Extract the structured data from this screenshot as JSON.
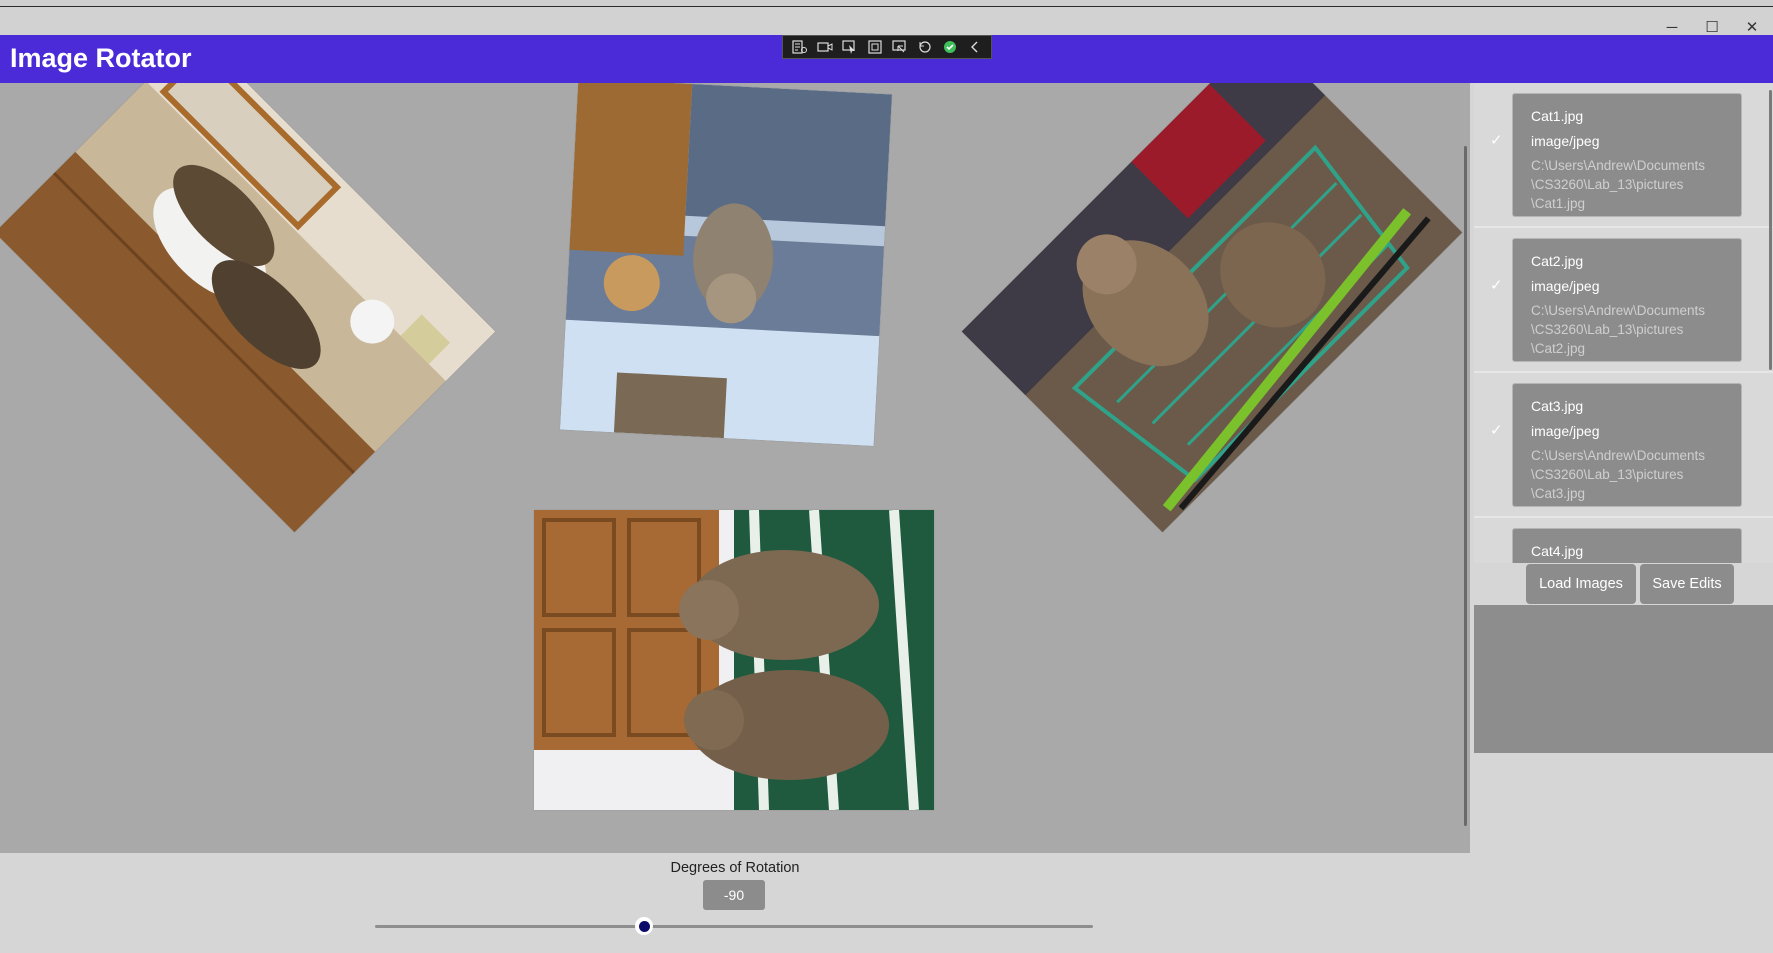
{
  "window": {
    "title": "Image Rotator",
    "controls": {
      "minimize": "─",
      "maximize": "☐",
      "close": "✕"
    }
  },
  "debug_toolbar": {
    "icons": [
      "live-visual-tree-icon",
      "select-element-icon",
      "display-layout-adorners-icon",
      "track-focus-icon",
      "hot-reload-icon",
      "binding-failures-icon",
      "collapse-chevron-icon"
    ]
  },
  "images": [
    {
      "name": "cat1-photo",
      "rotation_deg": 45
    },
    {
      "name": "cat2-photo",
      "rotation_deg": 183
    },
    {
      "name": "cat3-photo",
      "rotation_deg": -45
    },
    {
      "name": "cat4-photo",
      "rotation_deg": -90
    }
  ],
  "sidebar": {
    "items": [
      {
        "name": "Cat1.jpg",
        "type": "image/jpeg",
        "path": "C:\\Users\\Andrew\\Documents\n\\CS3260\\Lab_13\\pictures\n\\Cat1.jpg",
        "checked": "✓"
      },
      {
        "name": "Cat2.jpg",
        "type": "image/jpeg",
        "path": "C:\\Users\\Andrew\\Documents\n\\CS3260\\Lab_13\\pictures\n\\Cat2.jpg",
        "checked": "✓"
      },
      {
        "name": "Cat3.jpg",
        "type": "image/jpeg",
        "path": "C:\\Users\\Andrew\\Documents\n\\CS3260\\Lab_13\\pictures\n\\Cat3.jpg",
        "checked": "✓"
      },
      {
        "name": "Cat4.jpg",
        "type": "",
        "path": "",
        "checked": ""
      }
    ],
    "load_button": "Load Images",
    "save_button": "Save Edits"
  },
  "rotation": {
    "label": "Degrees of Rotation",
    "value": "-90",
    "slider_fraction": 0.375
  },
  "colors": {
    "accent": "#4b2bd8",
    "canvas": "#a9a9a9",
    "slider_thumb": "#0b0b6a"
  }
}
